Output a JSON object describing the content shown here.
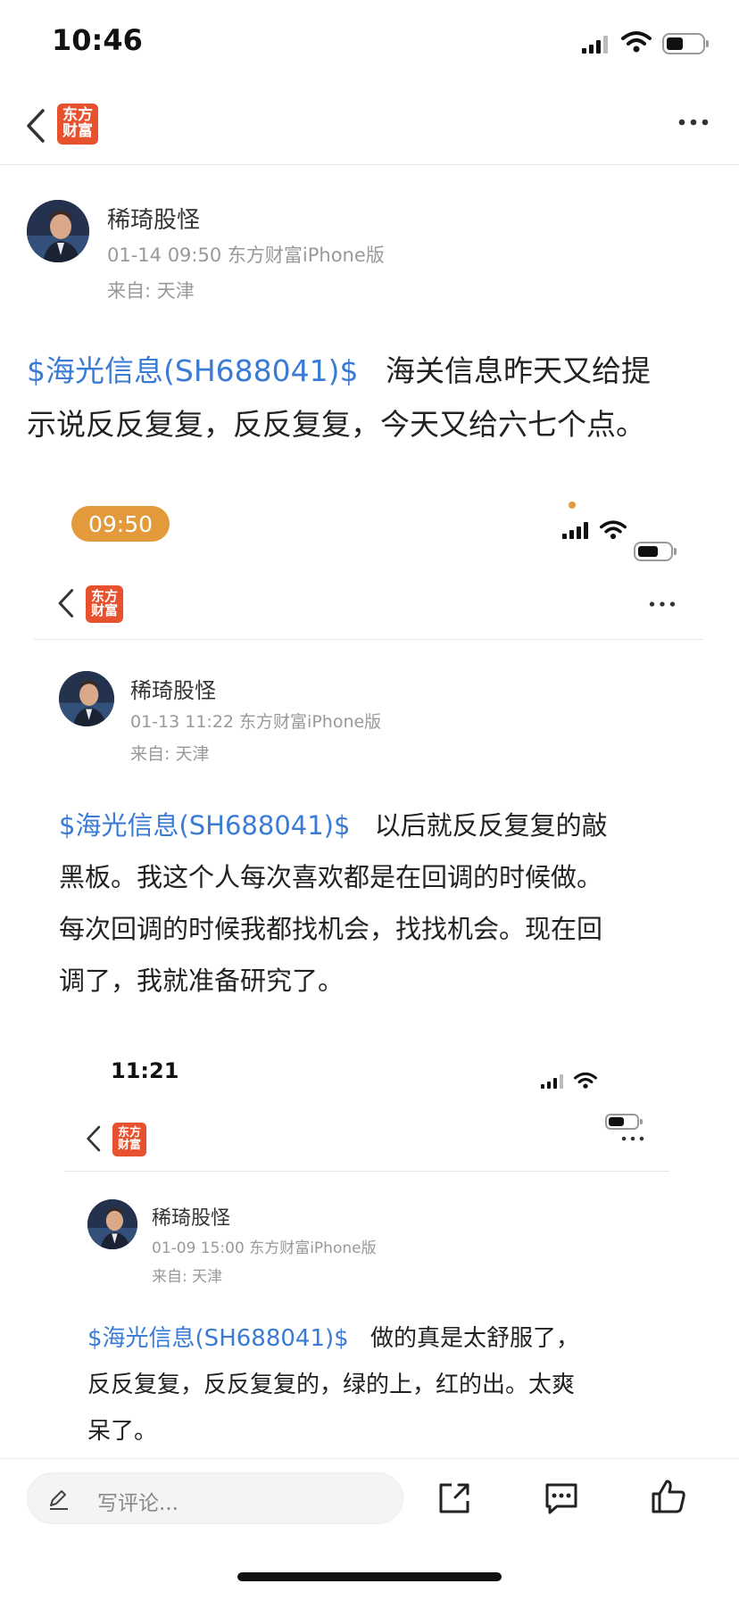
{
  "status": {
    "time": "10:46"
  },
  "nav": {
    "logo_line1": "东方",
    "logo_line2": "财富"
  },
  "post": {
    "author": "稀琦股怪",
    "meta": "01-14 09:50 东方财富iPhone版",
    "location": "来自: 天津",
    "tag": "$海光信息(SH688041)$",
    "text_line1": "海关信息昨天又给提",
    "text_line2": "示说反反复复，反反复复，今天又给六七个点。"
  },
  "shot1": {
    "time": "09:50",
    "author": "稀琦股怪",
    "meta": "01-13 11:22 东方财富iPhone版",
    "location": "来自: 天津",
    "tag": "$海光信息(SH688041)$",
    "text_line1": "以后就反反复复的敲",
    "text_line2": "黑板。我这个人每次喜欢都是在回调的时候做。",
    "text_line3": "每次回调的时候我都找机会，找找机会。现在回",
    "text_line4": "调了，我就准备研究了。"
  },
  "shot2": {
    "time": "11:21",
    "author": "稀琦股怪",
    "meta": "01-09 15:00 东方财富iPhone版",
    "location": "来自: 天津",
    "tag": "$海光信息(SH688041)$",
    "text_line1": "做的真是太舒服了，",
    "text_line2": "反反复复，反反复复的，绿的上，红的出。太爽",
    "text_line3": "呆了。"
  },
  "bottom": {
    "comment_placeholder": "写评论...",
    "icons": [
      "edit-icon",
      "share-icon",
      "comment-icon",
      "like-icon"
    ]
  },
  "colors": {
    "accent": "#3a7bd5",
    "brand": "#e8512e",
    "time_pill": "#e39a3b"
  }
}
